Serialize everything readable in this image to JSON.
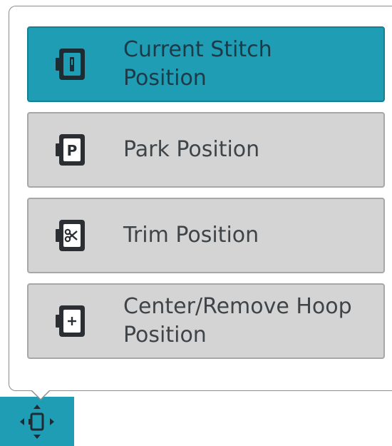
{
  "menu": {
    "items": [
      {
        "label": "Current Stitch\nPosition",
        "icon": "hoop-needle-icon",
        "selected": true
      },
      {
        "label": "Park Position",
        "icon": "hoop-park-icon",
        "selected": false
      },
      {
        "label": "Trim Position",
        "icon": "hoop-scissors-icon",
        "selected": false
      },
      {
        "label": "Center/Remove Hoop\nPosition",
        "icon": "hoop-center-icon",
        "selected": false
      }
    ]
  },
  "toolbar": {
    "toggle_icon": "move-hoop-icon"
  },
  "colors": {
    "accent": "#1f9db5",
    "button_bg": "#d4d4d4",
    "text": "#3f4448"
  }
}
